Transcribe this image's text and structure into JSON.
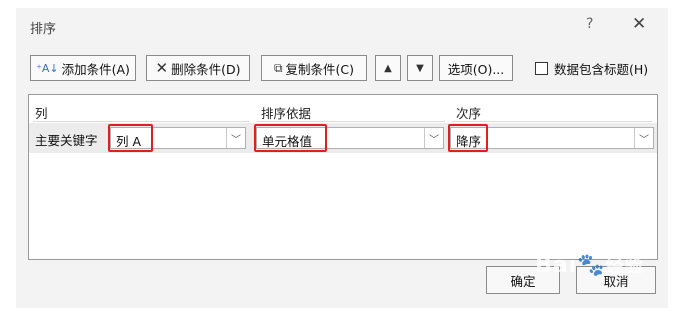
{
  "window": {
    "title": "排序",
    "help": "?",
    "close": "✕"
  },
  "toolbar": {
    "add_label": "添加条件(A)",
    "delete_label": "删除条件(D)",
    "copy_label": "复制条件(C)",
    "up_symbol": "▲",
    "down_symbol": "▼",
    "options_label": "选项(O)...",
    "header_checkbox_label": "数据包含标题(H)"
  },
  "grid": {
    "columns": [
      "列",
      "排序依据",
      "次序"
    ],
    "row": {
      "label": "主要关键字",
      "column_value": "列 A",
      "sort_on_value": "单元格值",
      "order_value": "降序"
    }
  },
  "footer": {
    "ok_label": "确定",
    "cancel_label": "取消"
  },
  "watermark": {
    "text": "Bai",
    "suffix": "经验"
  },
  "colors": {
    "highlight": "#e02020",
    "dialog_bg": "#f3f3f3"
  }
}
